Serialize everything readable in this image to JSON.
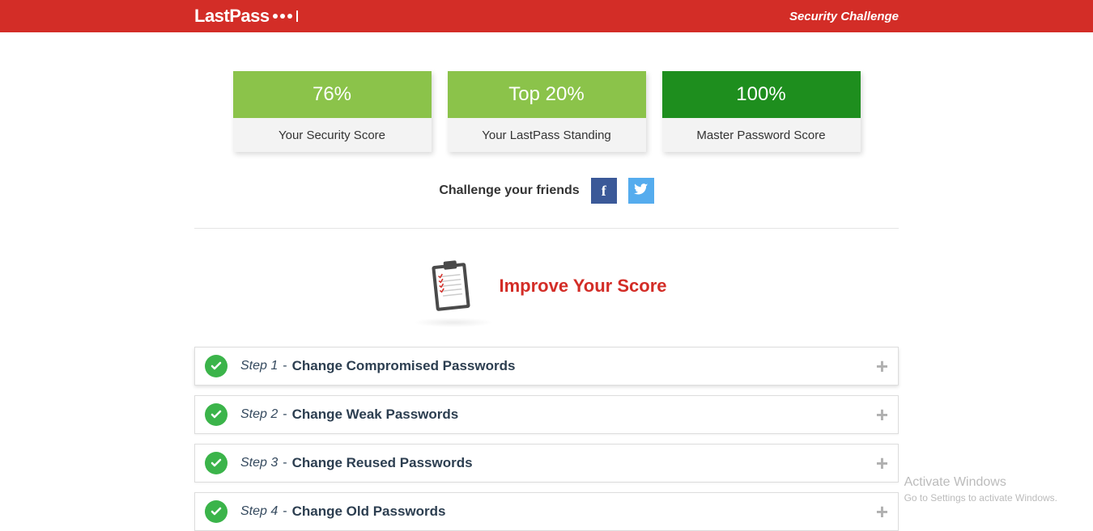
{
  "header": {
    "brand": "LastPass",
    "page_title": "Security Challenge"
  },
  "cards": {
    "security_score": {
      "value": "76%",
      "label": "Your Security Score"
    },
    "standing": {
      "value": "Top 20%",
      "label": "Your LastPass Standing"
    },
    "master_password": {
      "value": "100%",
      "label": "Master Password Score"
    }
  },
  "challenge": {
    "text": "Challenge your friends"
  },
  "improve": {
    "title": "Improve Your Score"
  },
  "steps": [
    {
      "step": "Step 1",
      "title": "Change Compromised Passwords"
    },
    {
      "step": "Step 2",
      "title": "Change Weak Passwords"
    },
    {
      "step": "Step 3",
      "title": "Change Reused Passwords"
    },
    {
      "step": "Step 4",
      "title": "Change Old Passwords"
    }
  ],
  "watermark": {
    "line1": "Activate Windows",
    "line2": "Go to Settings to activate Windows."
  }
}
